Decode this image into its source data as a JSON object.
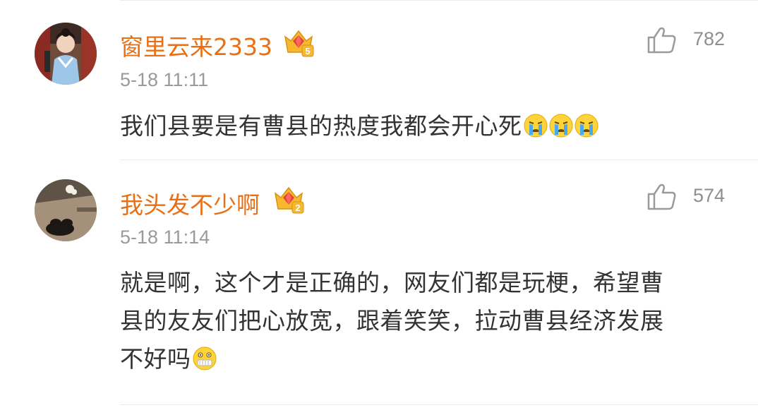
{
  "comments": [
    {
      "username": "窗里云来2333",
      "vip_level": "5",
      "timestamp": "5-18 11:11",
      "likes": "782",
      "text": "我们县要是有曹县的热度我都会开心死",
      "emojis": [
        "crying-emoji",
        "crying-emoji",
        "crying-emoji"
      ]
    },
    {
      "username": "我头发不少啊",
      "vip_level": "2",
      "timestamp": "5-18 11:14",
      "likes": "574",
      "text_lines": [
        "就是啊，这个才是正确的，网友们都是玩梗，希望曹",
        "县的友友们把心放宽，跟着笑笑，拉动曹县经济发展",
        "不好吗"
      ],
      "emojis": [
        "zipper-mouth-emoji"
      ]
    }
  ],
  "colors": {
    "username": "#e96f16",
    "timestamp": "#9a9a9a",
    "body_text": "#333333",
    "like_count": "#8e8e8e",
    "badge_gold": "#f5b82e",
    "badge_red": "#e8413a"
  }
}
